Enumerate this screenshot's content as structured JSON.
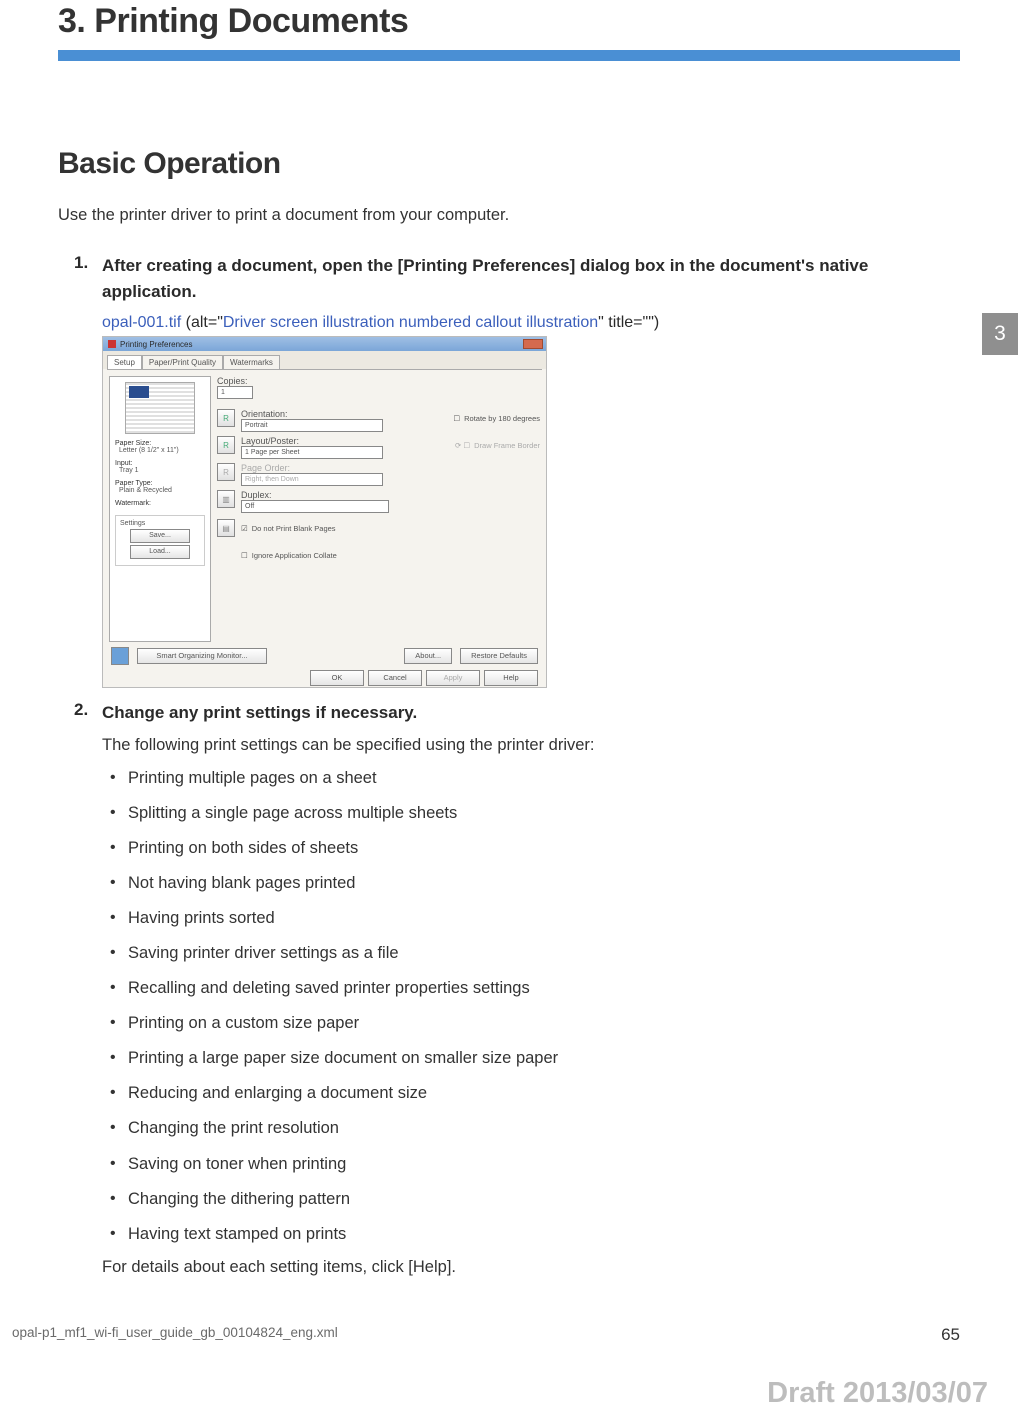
{
  "chapter": {
    "title": "3. Printing Documents"
  },
  "section": {
    "title": "Basic Operation"
  },
  "intro": "Use the printer driver to print a document from your computer.",
  "steps": [
    {
      "marker": "1.",
      "text": "After creating a document, open the [Printing Preferences] dialog box in the document's native application.",
      "anchor": {
        "file": "opal-001.tif",
        "pre": " (alt=\"",
        "alt": "Driver screen illustration numbered callout illustration",
        "post": "\" title=\"\")"
      }
    },
    {
      "marker": "2.",
      "text": "Change any print settings if necessary.",
      "sub": "The following print settings can be specified using the printer driver:",
      "bullets": [
        "Printing multiple pages on a sheet",
        "Splitting a single page across multiple sheets",
        "Printing on both sides of sheets",
        "Not having blank pages printed",
        "Having prints sorted",
        "Saving printer driver settings as a file",
        "Recalling and deleting saved printer properties settings",
        "Printing on a custom size paper",
        "Printing a large paper size document on smaller size paper",
        "Reducing and enlarging a document size",
        "Changing the print resolution",
        "Saving on toner when printing",
        "Changing the dithering pattern",
        "Having text stamped on prints"
      ],
      "closing": "For details about each setting items, click [Help]."
    }
  ],
  "screenshot": {
    "title": "Printing Preferences",
    "tabs": [
      "Setup",
      "Paper/Print Quality",
      "Watermarks"
    ],
    "left": {
      "paper_size_label": "Paper Size:",
      "paper_size_value": "Letter (8 1/2\" x 11\")",
      "input_label": "Input:",
      "input_value": "Tray 1",
      "paper_type_label": "Paper Type:",
      "paper_type_value": "Plain & Recycled",
      "watermark_label": "Watermark:",
      "settings_label": "Settings",
      "save_btn": "Save...",
      "load_btn": "Load..."
    },
    "right": {
      "copies_label": "Copies:",
      "copies_value": "1",
      "orientation_label": "Orientation:",
      "orientation_value": "Portrait",
      "rotate_label": "Rotate by 180 degrees",
      "layout_label": "Layout/Poster:",
      "layout_value": "1 Page per Sheet",
      "frame_label": "Draw Frame Border",
      "page_order_label": "Page Order:",
      "page_order_value": "Right, then Down",
      "duplex_label": "Duplex:",
      "duplex_value": "Off",
      "blank_label": "Do not Print Blank Pages",
      "collate_label": "Ignore Application Collate"
    },
    "bottom": {
      "som": "Smart Organizing Monitor...",
      "about": "About...",
      "restore": "Restore Defaults",
      "ok": "OK",
      "cancel": "Cancel",
      "apply": "Apply",
      "help": "Help"
    }
  },
  "side_tab": "3",
  "footer": {
    "file": "opal-p1_mf1_wi-fi_user_guide_gb_00104824_eng.xml",
    "page": "65"
  },
  "draft": "Draft 2013/03/07"
}
